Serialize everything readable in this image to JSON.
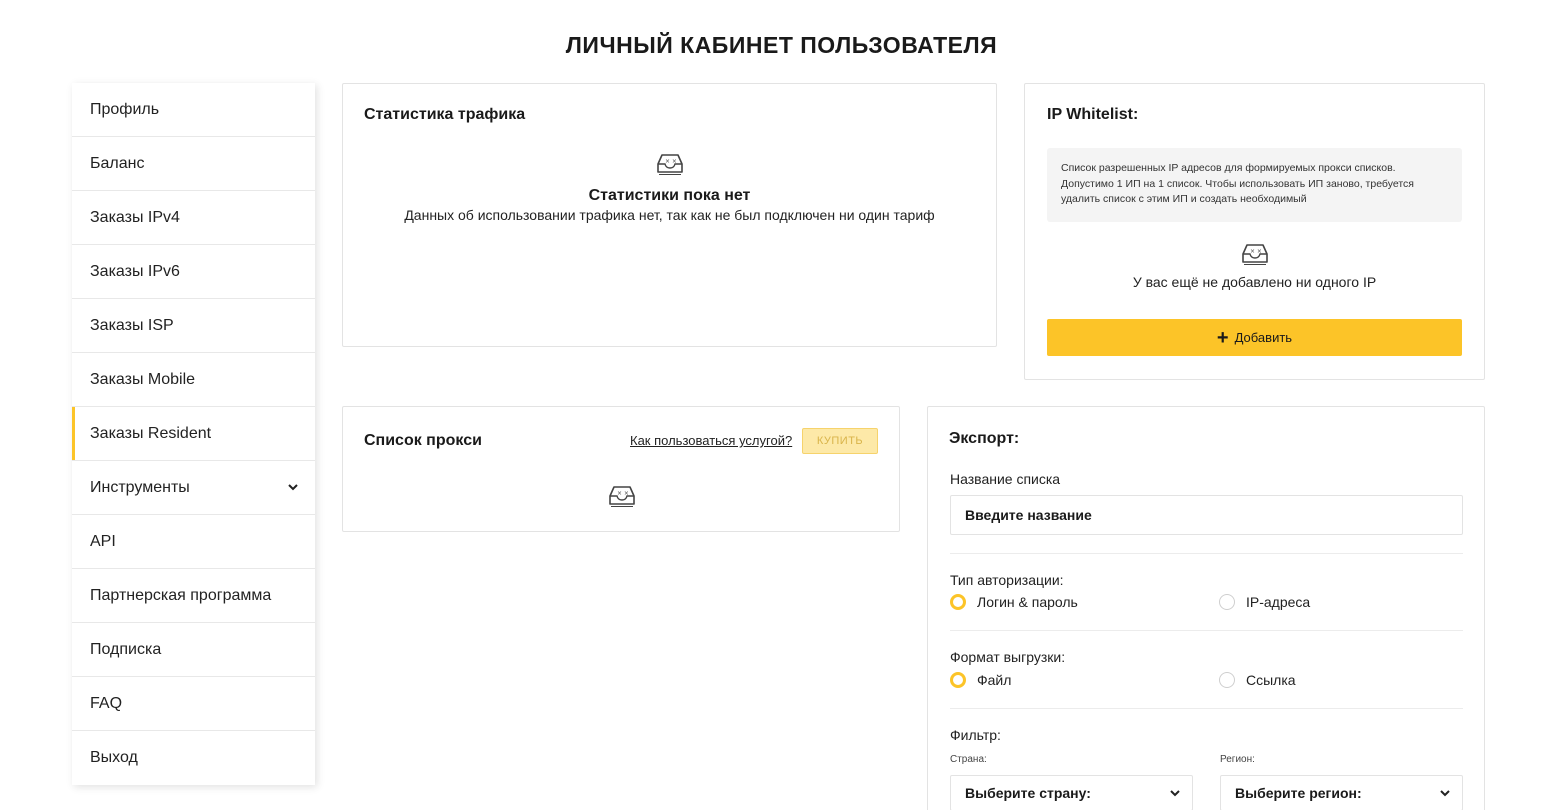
{
  "page": {
    "title": "ЛИЧНЫЙ КАБИНЕТ ПОЛЬЗОВАТЕЛЯ"
  },
  "colors": {
    "accent": "#fcc428",
    "accent_light": "#fde9a8",
    "border": "#e3e3e3"
  },
  "sidebar": {
    "active_item": "Заказы Resident",
    "items": [
      {
        "label": "Профиль"
      },
      {
        "label": "Баланс"
      },
      {
        "label": "Заказы IPv4"
      },
      {
        "label": "Заказы IPv6"
      },
      {
        "label": "Заказы ISP"
      },
      {
        "label": "Заказы Mobile"
      },
      {
        "label": "Заказы Resident"
      },
      {
        "label": "Инструменты",
        "icon": "chevron-down-icon"
      },
      {
        "label": "API"
      },
      {
        "label": "Партнерская программа"
      },
      {
        "label": "Подписка"
      },
      {
        "label": "FAQ"
      },
      {
        "label": "Выход"
      }
    ]
  },
  "traffic": {
    "title": "Статистика трафика",
    "empty_icon": "empty-inbox-icon",
    "empty_title": "Статистики пока нет",
    "empty_text": "Данных об использовании трафика нет, так как не был подключен ни один тариф"
  },
  "whitelist": {
    "title": "IP Whitelist:",
    "info_line1": "Список разрешенных IP адресов для формируемых прокси списков.",
    "info_line2": "Допустимо 1 ИП на 1 список. Чтобы использовать ИП заново, требуется",
    "info_line3": "удалить список с этим ИП и создать необходимый",
    "empty_icon": "empty-inbox-icon",
    "empty_text": "У вас ещё не добавлено ни одного IP",
    "add_icon": "plus-icon",
    "add_label": "Добавить"
  },
  "proxy": {
    "title": "Список прокси",
    "howto_link": "Как пользоваться услугой?",
    "buy_label": "КУПИТЬ",
    "empty_icon": "empty-inbox-icon"
  },
  "export": {
    "title": "Экспорт:",
    "name_label": "Название списка",
    "name_placeholder": "Введите название",
    "auth_label": "Тип авторизации:",
    "auth_options": [
      {
        "label": "Логин & пароль",
        "selected": true
      },
      {
        "label": "IP-адреса",
        "selected": false
      }
    ],
    "format_label": "Формат выгрузки:",
    "format_options": [
      {
        "label": "Файл",
        "selected": true
      },
      {
        "label": "Ссылка",
        "selected": false
      }
    ],
    "filter_label": "Фильтр:",
    "country_label": "Страна:",
    "country_value": "Выберите страну:",
    "region_label": "Регион:",
    "region_value": "Выберите регион:"
  }
}
